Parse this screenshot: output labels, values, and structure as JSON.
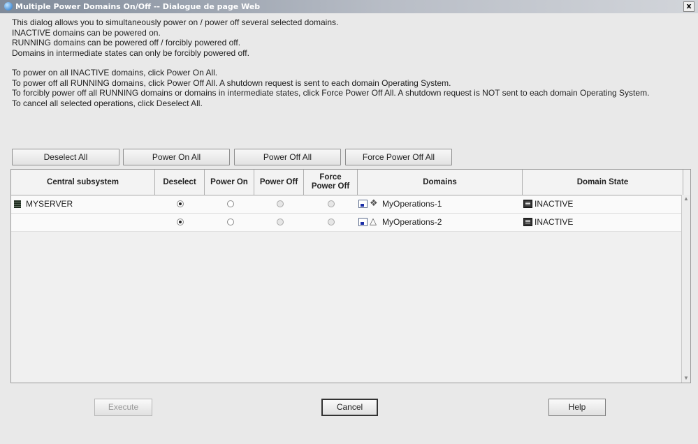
{
  "window": {
    "title": "Multiple Power Domains On/Off -- Dialogue de page Web",
    "close_label": "x"
  },
  "intro": {
    "lines_a": [
      "This dialog allows you to simultaneously power on / power off several selected domains.",
      "INACTIVE domains can be powered on.",
      "RUNNING domains can be powered off / forcibly powered off.",
      "Domains in intermediate states can only be forcibly powered off."
    ],
    "lines_b": [
      "To power on all INACTIVE domains, click Power On All.",
      "To power off all RUNNING domains, click Power Off All. A shutdown request is sent to each domain Operating System.",
      "To forcibly power off all RUNNING domains or domains in intermediate states, click Force Power Off All. A shutdown request is NOT sent to each domain Operating System.",
      "To cancel all selected operations, click Deselect All."
    ]
  },
  "toolbar": {
    "deselect_all": "Deselect All",
    "power_on_all": "Power On All",
    "power_off_all": "Power Off All",
    "force_power_off_all": "Force Power Off All"
  },
  "table": {
    "headers": {
      "central_subsystem": "Central subsystem",
      "deselect": "Deselect",
      "power_on": "Power On",
      "power_off": "Power Off",
      "force_power_off": "Force Power Off",
      "domains": "Domains",
      "domain_state": "Domain State"
    },
    "rows": [
      {
        "central_subsystem": "MYSERVER",
        "selected": "deselect",
        "os_icon": "windows-icon",
        "domain": "MyOperations-1",
        "state": "INACTIVE"
      },
      {
        "central_subsystem": "",
        "selected": "deselect",
        "os_icon": "linux-icon",
        "domain": "MyOperations-2",
        "state": "INACTIVE"
      }
    ]
  },
  "footer": {
    "execute": "Execute",
    "cancel": "Cancel",
    "help": "Help"
  }
}
